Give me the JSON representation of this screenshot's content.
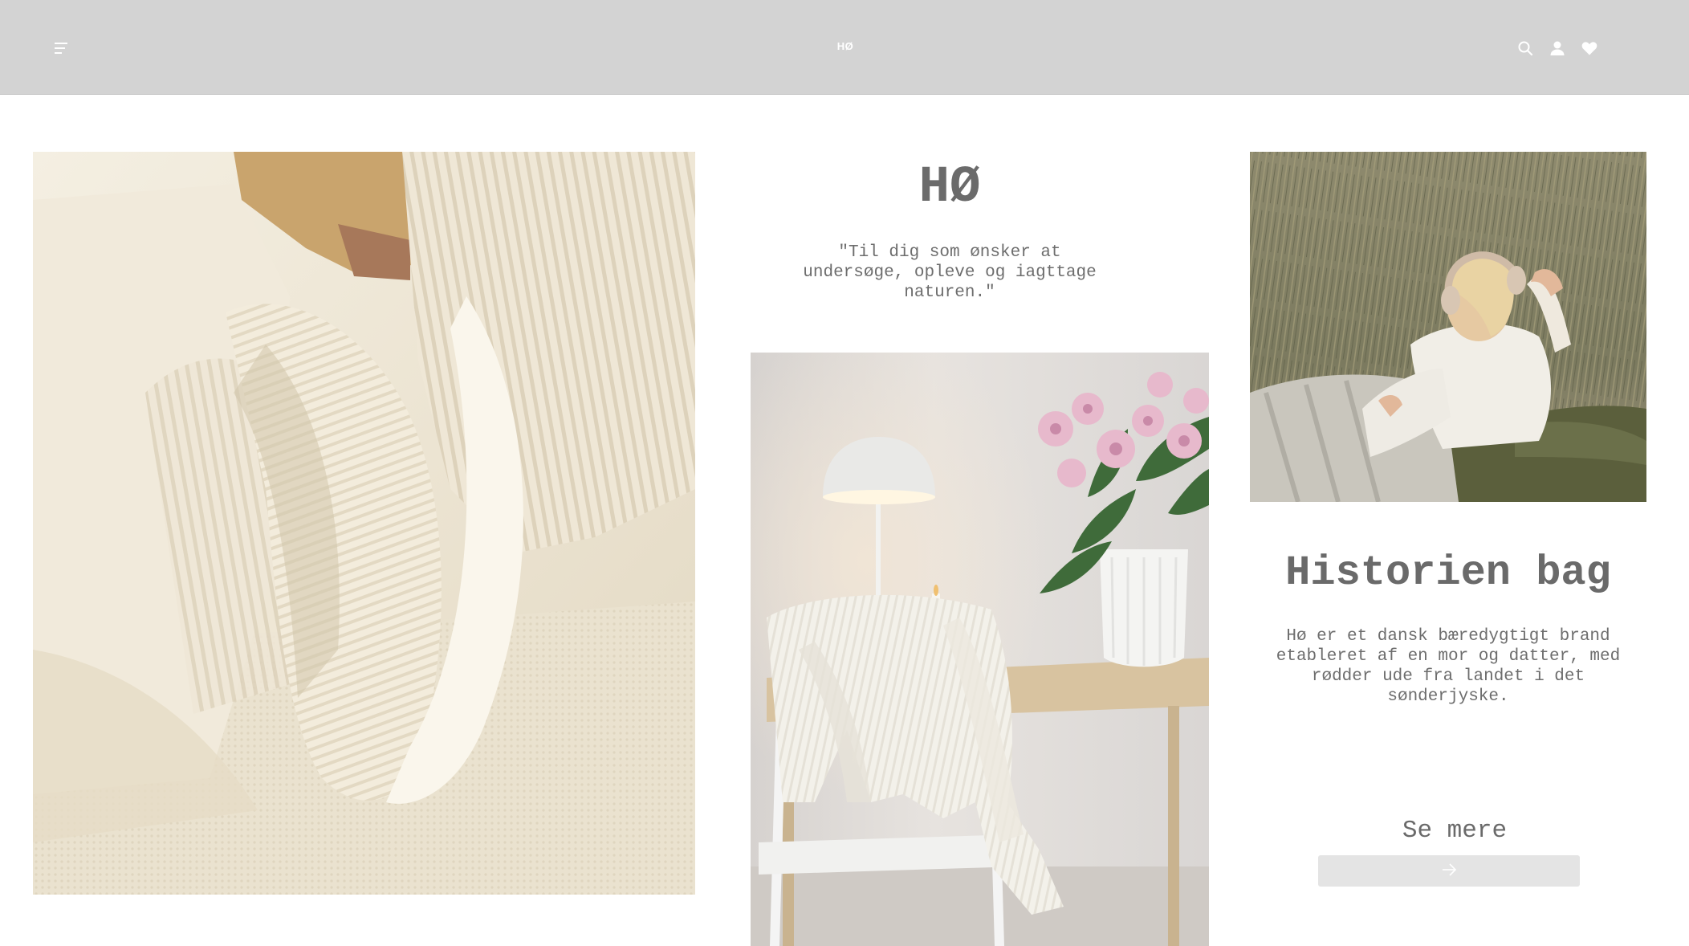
{
  "header": {
    "logo": "HØ",
    "menu_icon": "menu-icon",
    "icons": [
      "search-icon",
      "user-icon",
      "heart-icon"
    ]
  },
  "hero": {
    "brand_title": "HØ",
    "tagline": "\"Til dig som ønsker at undersøge, opleve og iagttage naturen.\""
  },
  "story": {
    "title": "Historien bag",
    "text": "Hø er et dansk bæredygtigt brand etableret af en mor og datter, med rødder ude fra landet i det sønderjyske.",
    "see_more": "Se mere",
    "arrow_icon": "arrow-right-icon"
  },
  "colors": {
    "header_bg": "#d3d3d3",
    "text_gray": "#6b6b6b",
    "button_bg": "#e4e4e4"
  }
}
